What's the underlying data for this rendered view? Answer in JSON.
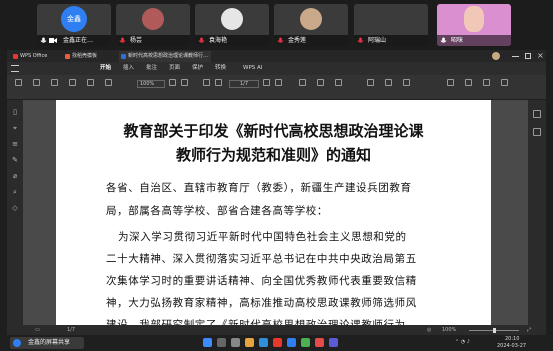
{
  "meeting": {
    "participants": [
      {
        "avatar_text": "金鑫",
        "name": "金鑫正在…",
        "avatar_color": "#2f7ff2"
      },
      {
        "avatar_text": "",
        "name": "杨芸",
        "avatar_color": "#b05a5a"
      },
      {
        "avatar_text": "",
        "name": "袁海艳",
        "avatar_color": "#e6e6e6"
      },
      {
        "avatar_text": "",
        "name": "金秀莲",
        "avatar_color": "#c9a98a"
      },
      {
        "avatar_text": "",
        "name": "阿瑞山",
        "avatar_color": "#3b3b3b"
      },
      {
        "avatar_text": "",
        "name": "昭咪",
        "avatar_color": "#d98fd0"
      }
    ]
  },
  "wps": {
    "tabs": [
      "WPS Office",
      "找稻壳模板",
      "新时代高校思想政治理论课教师行…"
    ],
    "menu": [
      "开始",
      "插入",
      "批注",
      "页面",
      "保护",
      "转换",
      "WPS AI"
    ],
    "toolbar": {
      "zoom": "100%",
      "page_input": "1/7"
    }
  },
  "document": {
    "title_line1": "教育部关于印发《新时代高校思想政治理论课",
    "title_line2": "教师行为规范和准则》的通知",
    "recipient_line1": "各省、自治区、直辖市教育厅（教委），新疆生产建设兵团教育",
    "recipient_line2": "局，部属各高等学校、部省合建各高等学校：",
    "body_lines": [
      "为深入学习贯彻习近平新时代中国特色社会主义思想和党的",
      "二十大精神、深入贯彻落实习近平总书记在中共中央政治局第五",
      "次集体学习时的重要讲话精神、向全国优秀教师代表重要致信精",
      "神，大力弘扬教育家精神，高标准推动高校思政课教师筛选师风",
      "建设，我部研究制定了《新时代高校思想政治理论课教师行为"
    ]
  },
  "status": {
    "page": "1/7",
    "zoom": "100%"
  },
  "taskbar": {
    "share_label": "金鑫的屏幕共享",
    "time": "20:10",
    "date": "2024-03-27"
  }
}
